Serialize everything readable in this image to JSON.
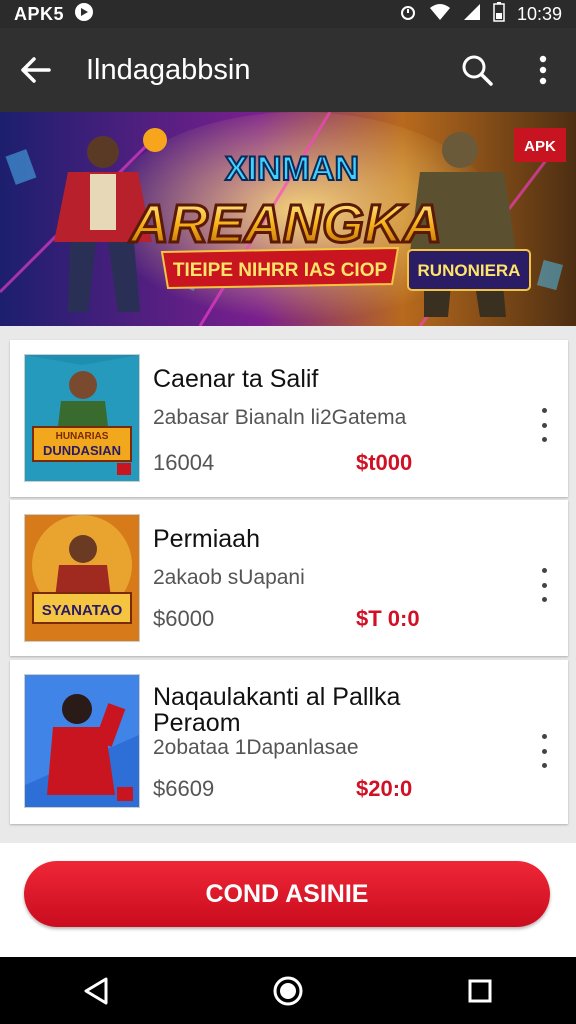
{
  "status": {
    "left_text": "APK5",
    "time": "10:39"
  },
  "appbar": {
    "title": "Ilndagabbsin"
  },
  "banner": {
    "headline_top": "XINMAN",
    "headline_main": "AREANGKA",
    "ribbon": "TIEIPE NIHRR IAS CIOP",
    "badge_right": "RUNONIERA",
    "tag": "APK"
  },
  "items": [
    {
      "title": "Caenar ta Salif",
      "subtitle": "2abasar Bianaln li2Gatema",
      "price": "16004",
      "sale": "$t000",
      "thumb_text": "DUNDASIAN",
      "thumb_text2": "HUNARIAS"
    },
    {
      "title": "Permiaah",
      "subtitle": "2akaob sUapani",
      "price": "$6000",
      "sale": "$T 0:0",
      "thumb_text": "SYANATAO",
      "thumb_text2": ""
    },
    {
      "title": "Naqaulakanti al Pallka",
      "title2": "Peraom",
      "subtitle": "2obataa 1Dapanlasae",
      "price": "$6609",
      "sale": "$20:0",
      "thumb_text": "",
      "thumb_text2": ""
    }
  ],
  "cta": {
    "label": "COND ASINIE"
  },
  "colors": {
    "accent": "#d01024",
    "appbar": "#303030",
    "statusbar": "#2b2b2b"
  }
}
